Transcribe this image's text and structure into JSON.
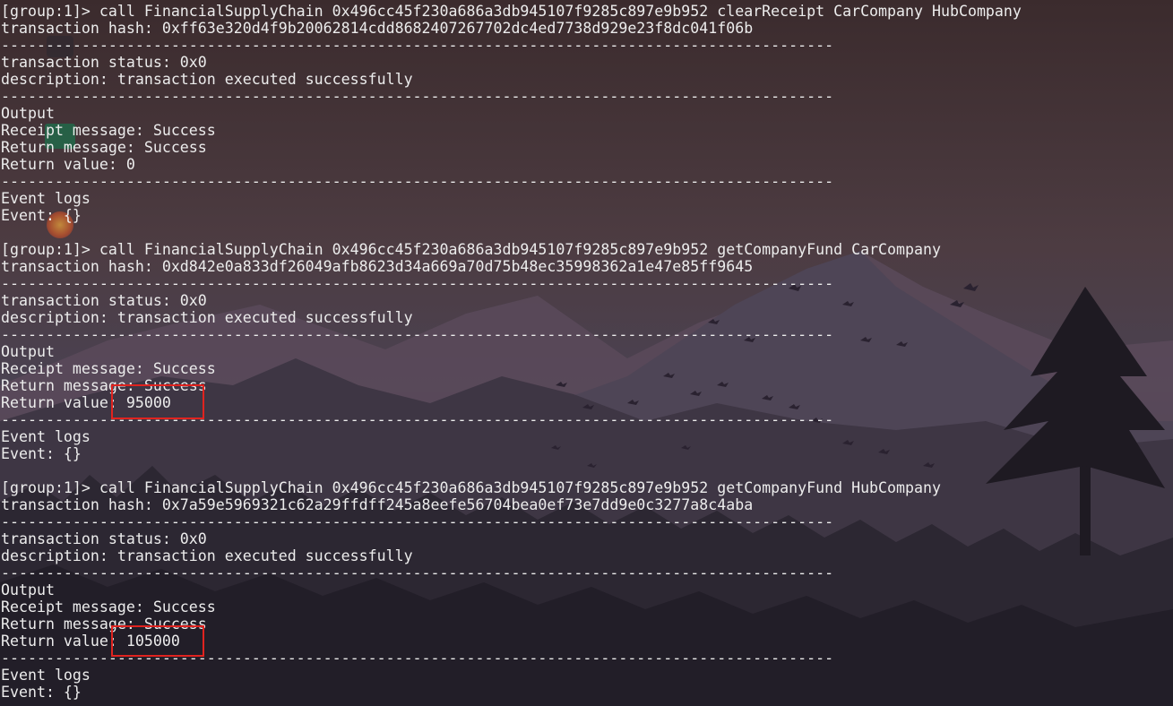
{
  "terminal": {
    "lines": [
      "[group:1]> call FinancialSupplyChain 0x496cc45f230a686a3db945107f9285c897e9b952 clearReceipt CarCompany HubCompany",
      "transaction hash: 0xff63e320d4f9b20062814cdd8682407267702dc4ed7738d929e23f8dc041f06b",
      "---------------------------------------------------------------------------------------------",
      "transaction status: 0x0",
      "description: transaction executed successfully",
      "---------------------------------------------------------------------------------------------",
      "Output",
      "Receipt message: Success",
      "Return message: Success",
      "Return value: 0",
      "---------------------------------------------------------------------------------------------",
      "Event logs",
      "Event: {}",
      "",
      "[group:1]> call FinancialSupplyChain 0x496cc45f230a686a3db945107f9285c897e9b952 getCompanyFund CarCompany",
      "transaction hash: 0xd842e0a833df26049afb8623d34a669a70d75b48ec35998362a1e47e85ff9645",
      "---------------------------------------------------------------------------------------------",
      "transaction status: 0x0",
      "description: transaction executed successfully",
      "---------------------------------------------------------------------------------------------",
      "Output",
      "Receipt message: Success",
      "Return message: Success",
      "Return value: 95000",
      "---------------------------------------------------------------------------------------------",
      "Event logs",
      "Event: {}",
      "",
      "[group:1]> call FinancialSupplyChain 0x496cc45f230a686a3db945107f9285c897e9b952 getCompanyFund HubCompany",
      "transaction hash: 0x7a59e5969321c62a29ffdff245a8eefe56704bea0ef73e7dd9e0c3277a8c4aba",
      "---------------------------------------------------------------------------------------------",
      "transaction status: 0x0",
      "description: transaction executed successfully",
      "---------------------------------------------------------------------------------------------",
      "Output",
      "Receipt message: Success",
      "Return message: Success",
      "Return value: 105000",
      "---------------------------------------------------------------------------------------------",
      "Event logs",
      "Event: {}"
    ]
  },
  "colors": {
    "text": "#ececec",
    "highlight_border": "#e0231f"
  }
}
